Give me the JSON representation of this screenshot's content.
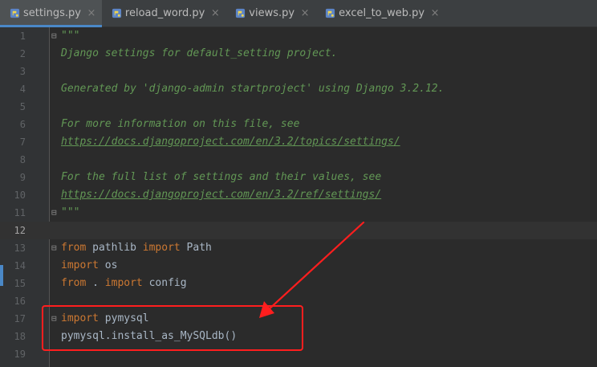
{
  "tabs": [
    {
      "label": "settings.py",
      "icon": "python-file-icon",
      "active": true
    },
    {
      "label": "reload_word.py",
      "icon": "python-file-icon",
      "active": false
    },
    {
      "label": "views.py",
      "icon": "python-file-icon",
      "active": false
    },
    {
      "label": "excel_to_web.py",
      "icon": "python-file-icon",
      "active": false
    }
  ],
  "tab_close_glyph": "×",
  "fold_glyph": "⊟",
  "lines": [
    {
      "n": "1",
      "text": "\"\"\""
    },
    {
      "n": "2",
      "text": "Django settings for default_setting project."
    },
    {
      "n": "3",
      "text": ""
    },
    {
      "n": "4",
      "text": "Generated by 'django-admin startproject' using Django 3.2.12."
    },
    {
      "n": "5",
      "text": ""
    },
    {
      "n": "6",
      "text": "For more information on this file, see"
    },
    {
      "n": "7",
      "text": "https://docs.djangoproject.com/en/3.2/topics/settings/"
    },
    {
      "n": "8",
      "text": ""
    },
    {
      "n": "9",
      "text": "For the full list of settings and their values, see"
    },
    {
      "n": "10",
      "text": "https://docs.djangoproject.com/en/3.2/ref/settings/"
    },
    {
      "n": "11",
      "text": "\"\"\""
    },
    {
      "n": "12",
      "text": ""
    },
    {
      "n": "13",
      "parts": [
        {
          "text": "from",
          "kind": "kw"
        },
        {
          "text": " pathlib ",
          "kind": "ident"
        },
        {
          "text": "import",
          "kind": "kw"
        },
        {
          "text": " Path",
          "kind": "ident"
        }
      ]
    },
    {
      "n": "14",
      "parts": [
        {
          "text": "import",
          "kind": "kw"
        },
        {
          "text": " os",
          "kind": "ident"
        }
      ]
    },
    {
      "n": "15",
      "parts": [
        {
          "text": "from",
          "kind": "kw"
        },
        {
          "text": " . ",
          "kind": "ident"
        },
        {
          "text": "import",
          "kind": "kw"
        },
        {
          "text": " config",
          "kind": "ident"
        }
      ]
    },
    {
      "n": "16",
      "text": ""
    },
    {
      "n": "17",
      "parts": [
        {
          "text": "import",
          "kind": "kw"
        },
        {
          "text": " pymysql",
          "kind": "ident"
        }
      ]
    },
    {
      "n": "18",
      "parts": [
        {
          "text": "pymysql.install_as_MySQLdb()",
          "kind": "ident"
        }
      ]
    },
    {
      "n": "19",
      "text": ""
    }
  ],
  "colors": {
    "editor_bg": "#2b2b2b",
    "gutter_bg": "#313335",
    "docstring": "#629755",
    "keyword": "#cc7832",
    "identifier": "#a9b7c6",
    "annotation_red": "#ff1e1e",
    "active_tab_underline": "#4a88c7"
  }
}
